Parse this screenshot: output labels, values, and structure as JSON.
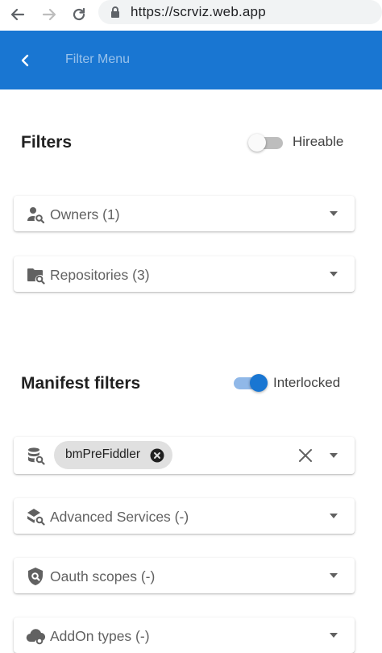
{
  "browser": {
    "url": "https://scrviz.web.app",
    "back_icon": "arrow-left-icon",
    "forward_icon": "arrow-right-icon",
    "reload_icon": "reload-icon",
    "lock_icon": "lock-icon"
  },
  "app_bar": {
    "title": "Filter Menu",
    "back_icon": "chevron-left-icon",
    "color": "#1976d2"
  },
  "filters": {
    "title": "Filters",
    "toggle_label": "Hireable",
    "toggle_on": false,
    "items": [
      {
        "label": "Owners (1)",
        "icon": "person-search-icon"
      },
      {
        "label": "Repositories (3)",
        "icon": "folder-search-icon"
      }
    ]
  },
  "manifest": {
    "title": "Manifest filters",
    "toggle_label": "Interlocked",
    "toggle_on": true,
    "selector": {
      "icon": "database-search-icon",
      "chip_label": "bmPreFiddler"
    },
    "items": [
      {
        "label": "Advanced Services (-)",
        "icon": "services-search-icon"
      },
      {
        "label": "Oauth scopes (-)",
        "icon": "shield-search-icon"
      },
      {
        "label": "AddOn types (-)",
        "icon": "cloud-search-icon"
      }
    ]
  },
  "accent": "#1976d2"
}
